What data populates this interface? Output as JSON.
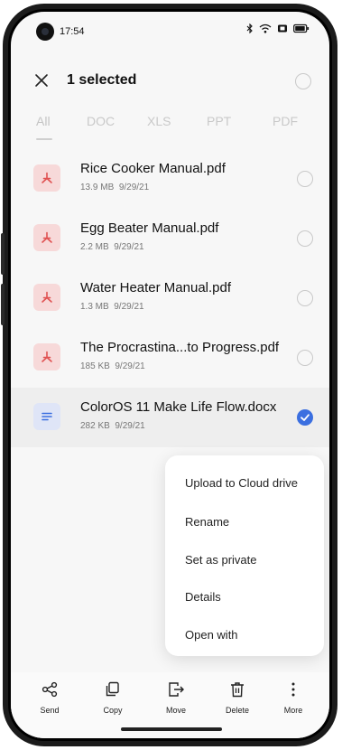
{
  "status_bar": {
    "time": "17:54"
  },
  "header": {
    "title": "1 selected"
  },
  "tabs": [
    {
      "label": "All"
    },
    {
      "label": "DOC"
    },
    {
      "label": "XLS"
    },
    {
      "label": "PPT"
    },
    {
      "label": "PDF"
    }
  ],
  "files": [
    {
      "name": "Rice Cooker Manual.pdf",
      "size": "13.9 MB",
      "date": "9/29/21",
      "type": "pdf",
      "selected": false
    },
    {
      "name": "Egg Beater Manual.pdf",
      "size": "2.2 MB",
      "date": "9/29/21",
      "type": "pdf",
      "selected": false
    },
    {
      "name": "Water Heater Manual.pdf",
      "size": "1.3 MB",
      "date": "9/29/21",
      "type": "pdf",
      "selected": false
    },
    {
      "name": "The Procrastina...to Progress.pdf",
      "size": "185 KB",
      "date": "9/29/21",
      "type": "pdf",
      "selected": false
    },
    {
      "name": "ColorOS 11 Make Life Flow.docx",
      "size": "282 KB",
      "date": "9/29/21",
      "type": "docx",
      "selected": true
    }
  ],
  "menu": [
    {
      "label": "Upload to Cloud drive"
    },
    {
      "label": "Rename"
    },
    {
      "label": "Set as private"
    },
    {
      "label": "Details"
    },
    {
      "label": "Open with"
    }
  ],
  "toolbar": [
    {
      "label": "Send",
      "icon": "share-icon"
    },
    {
      "label": "Copy",
      "icon": "copy-icon"
    },
    {
      "label": "Move",
      "icon": "move-icon"
    },
    {
      "label": "Delete",
      "icon": "delete-icon"
    },
    {
      "label": "More",
      "icon": "more-icon"
    }
  ],
  "colors": {
    "accent": "#3b6fe0",
    "pdf_icon": "#e05252",
    "doc_icon": "#3b6fe0"
  }
}
